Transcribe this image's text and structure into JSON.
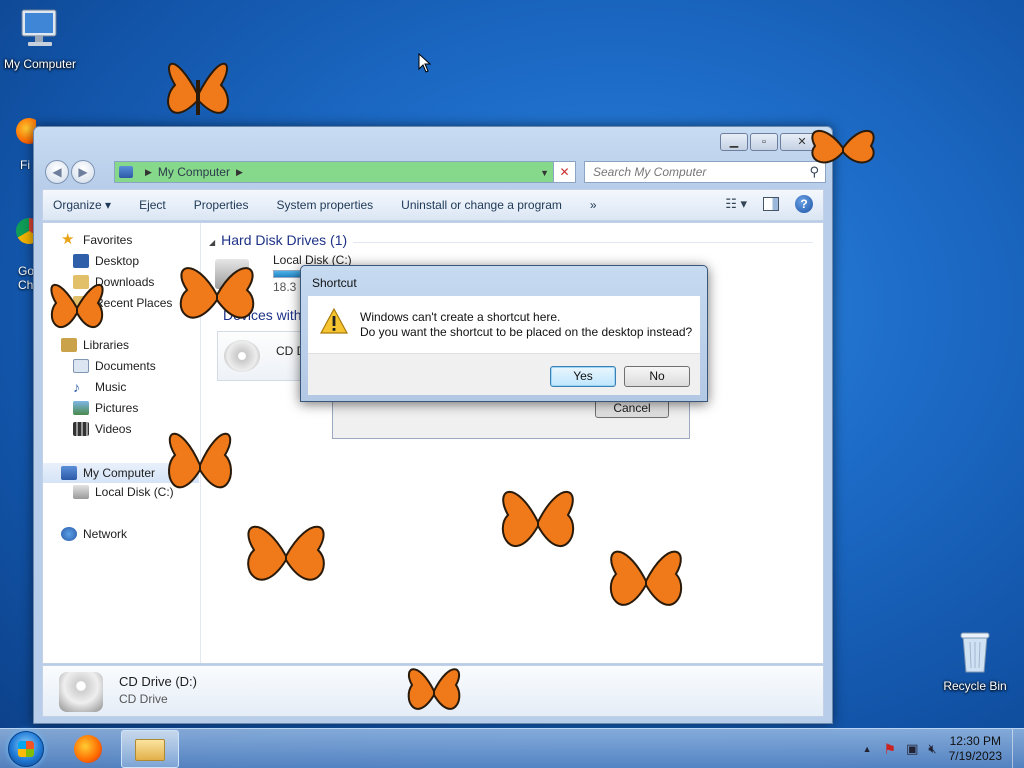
{
  "desktop": {
    "icons": {
      "my_computer": "My Computer",
      "recycle_bin": "Recycle Bin",
      "partial_1": "Fi",
      "partial_2_line1": "Go",
      "partial_2_line2": "Ch"
    }
  },
  "explorer": {
    "address": {
      "crumb": "My Computer"
    },
    "search": {
      "placeholder": "Search My Computer"
    },
    "toolbar": {
      "organize": "Organize",
      "eject": "Eject",
      "properties": "System properties",
      "properties_short": "Properties",
      "uninstall": "Uninstall or change a program",
      "more": "»"
    },
    "navpane": {
      "favorites": "Favorites",
      "desktop": "Desktop",
      "downloads": "Downloads",
      "recent": "Recent Places",
      "libraries": "Libraries",
      "documents": "Documents",
      "music": "Music",
      "pictures": "Pictures",
      "videos": "Videos",
      "my_computer": "My Computer",
      "local_disk": "Local Disk (C:)",
      "network": "Network"
    },
    "main": {
      "hdd_group": "Hard Disk Drives (1)",
      "local_disk_label": "Local Disk (C:)",
      "local_disk_free": "18.3 G",
      "devices_group": "Devices with",
      "cd_label": "CD D"
    },
    "details": {
      "name": "CD Drive (D:)",
      "type": "CD Drive"
    }
  },
  "background_dialog": {
    "cancel": "Cancel"
  },
  "dialog": {
    "title": "Shortcut",
    "line1": "Windows can't create a shortcut here.",
    "line2": "Do you want the shortcut to be placed on the desktop instead?",
    "yes": "Yes",
    "no": "No"
  },
  "taskbar": {
    "time": "12:30 PM",
    "date": "7/19/2023"
  },
  "colors": {
    "address_bar": "#86d88a",
    "butterfly": "#f07a1a"
  }
}
